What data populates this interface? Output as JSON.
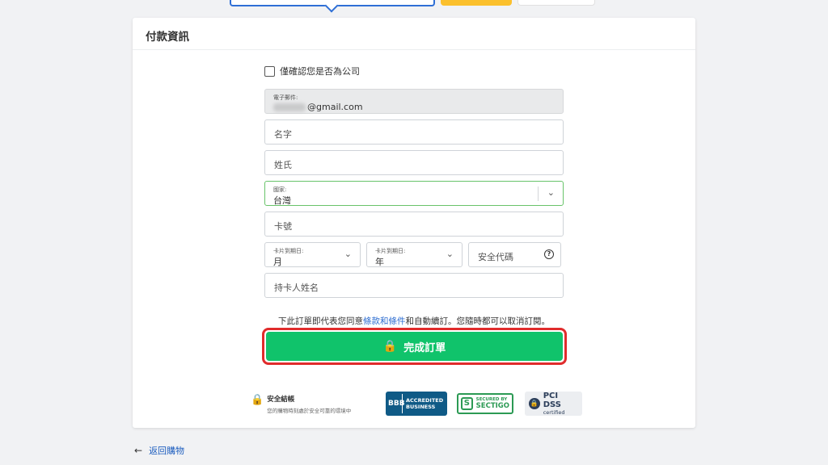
{
  "header": {
    "title": "付款資訊"
  },
  "form": {
    "company_label": "僅確認您是否為公司",
    "email": {
      "label": "電子郵件:",
      "value": "@gmail.com"
    },
    "first_name": {
      "placeholder": "名字"
    },
    "last_name": {
      "placeholder": "姓氏"
    },
    "country": {
      "label": "國家:",
      "value": "台灣"
    },
    "card_number": {
      "placeholder": "卡號"
    },
    "exp_month": {
      "label": "卡片到期日:",
      "value": "月"
    },
    "exp_year": {
      "label": "卡片到期日:",
      "value": "年"
    },
    "cvv": {
      "placeholder": "安全代碼"
    },
    "cardholder": {
      "placeholder": "持卡人姓名"
    }
  },
  "terms": {
    "prefix": "下此訂單即代表您同意",
    "link": "條款和條件",
    "suffix": "和自動續訂。您隨時都可以取消訂閱。"
  },
  "submit": {
    "label": "完成訂單"
  },
  "secure": {
    "title": "安全結帳",
    "subtitle": "您的購物時刻處於安全可靠的環境中"
  },
  "badges": {
    "bbb": {
      "logo": "BBB",
      "line1": "ACCREDITED",
      "line2": "BUSINESS"
    },
    "sectigo": {
      "small": "SECURED BY",
      "big": "SECTIGO"
    },
    "pci": {
      "big": "PCI DSS",
      "small": "certified"
    }
  },
  "back": {
    "label": "返回購物"
  },
  "colors": {
    "accent": "#10c36b",
    "link": "#2c6cd0",
    "highlight": "#e02c2c"
  }
}
